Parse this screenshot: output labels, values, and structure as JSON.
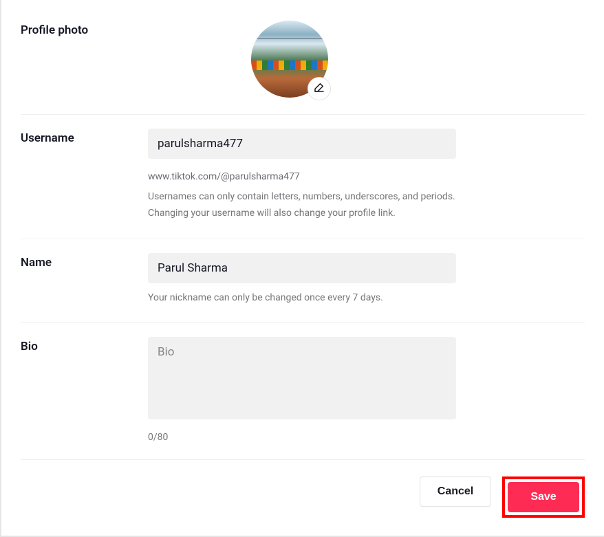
{
  "sections": {
    "photo": {
      "label": "Profile photo"
    },
    "username": {
      "label": "Username",
      "value": "parulsharma477",
      "url": "www.tiktok.com/@parulsharma477",
      "help": "Usernames can only contain letters, numbers, underscores, and periods. Changing your username will also change your profile link."
    },
    "name": {
      "label": "Name",
      "value": "Parul Sharma",
      "help": "Your nickname can only be changed once every 7 days."
    },
    "bio": {
      "label": "Bio",
      "placeholder": "Bio",
      "value": "",
      "counter": "0/80"
    }
  },
  "footer": {
    "cancel": "Cancel",
    "save": "Save"
  }
}
